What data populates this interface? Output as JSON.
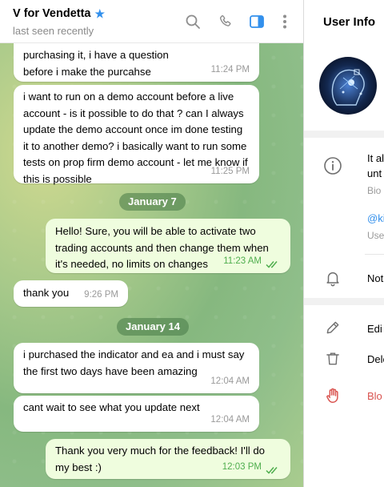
{
  "chat": {
    "title": "V for Vendetta",
    "status": "last seen recently",
    "messages": [
      {
        "text": "purchasing it, i have a question before i make the purcahse",
        "time": "11:24 PM"
      },
      {
        "text": "i want to run on a demo account before a live account - is it possible to do that ? can I always update the demo account once im done testing it to another demo? i basically want to run some tests on prop firm demo account - let me know if this is possible",
        "time": "11:25 PM"
      },
      {
        "text": "Hello! Sure, you will be able to activate two trading accounts and then change them when it's needed, no limits on changes",
        "time": "11:23 AM"
      },
      {
        "text": "thank you",
        "time": "9:26 PM"
      },
      {
        "text": "i purchased the indicator and ea and i must say the first two days have been amazing",
        "time": "12:04 AM"
      },
      {
        "text": "cant wait to see what you update next",
        "time": "12:04 AM"
      },
      {
        "text": "Thank you very much for the feedback! I'll do my best :)",
        "time": "12:03 PM"
      }
    ],
    "dates": [
      "January 7",
      "January 14"
    ]
  },
  "info": {
    "title": "User Info",
    "bio_text": "It al",
    "bio_text_2": "unt",
    "bio_label": "Bio",
    "username": "@ki",
    "username_label": "Use",
    "notifications": "Not",
    "edit": "Edi",
    "delete": "Dele",
    "block": "Blo"
  },
  "colors": {
    "accent": "#3390ec",
    "outgoing_bubble": "#effdde",
    "outgoing_time": "#4fae4e",
    "danger": "#d9534f"
  },
  "icons": [
    "search-icon",
    "phone-icon",
    "sidebar-toggle-icon",
    "more-vertical-icon",
    "info-icon",
    "bell-icon",
    "pencil-icon",
    "trash-icon",
    "hand-block-icon",
    "double-check-icon",
    "star-icon"
  ]
}
